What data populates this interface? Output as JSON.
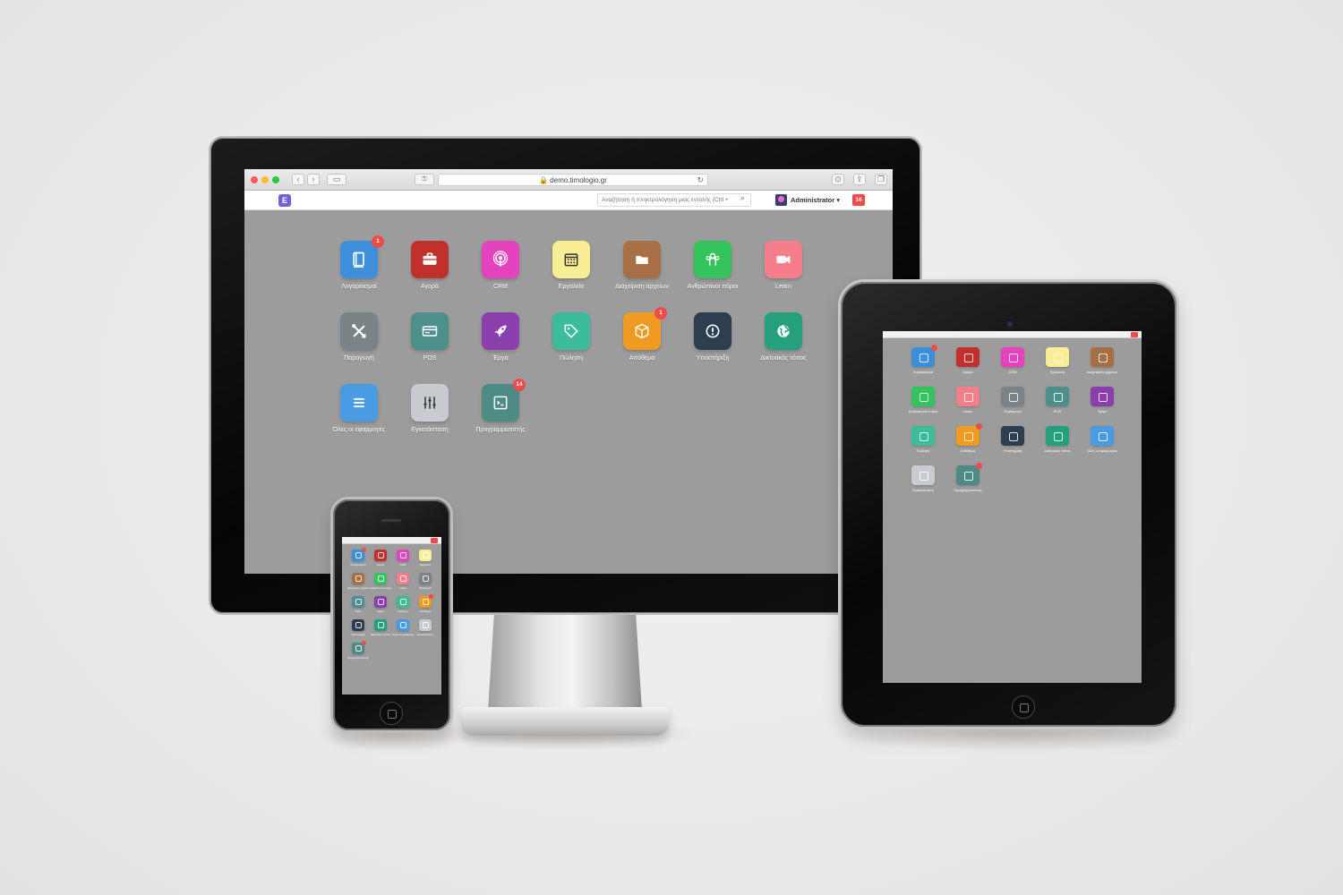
{
  "browser": {
    "url": "demo.timologio.gr",
    "back_label": "‹",
    "forward_label": "›",
    "sidebar_label": "▭",
    "key_label": "⚿",
    "reload_label": "↻",
    "download_label": "⊙",
    "share_label": "⇪",
    "tabs_label": "❐"
  },
  "navbar": {
    "logo_letter": "E",
    "search_placeholder": "Αναζήτηση ή πληκτρολόγηση μιας εντολής (Ctrl + ",
    "user_name": "Administrator ▾",
    "notification_count": "16"
  },
  "apps": [
    {
      "label": "Λογαριασμοί",
      "color": "#3d8fdc",
      "icon": "book-icon",
      "badge": "1"
    },
    {
      "label": "Αγορά",
      "color": "#c0302c",
      "icon": "briefcase-icon",
      "badge": ""
    },
    {
      "label": "CRM",
      "color": "#e542bd",
      "icon": "podcast-icon",
      "badge": ""
    },
    {
      "label": "Εργαλεία",
      "color": "#f9ee96",
      "icon": "calendar-icon",
      "badge": ""
    },
    {
      "label": "Διαχείριση αρχείων",
      "color": "#a66f45",
      "icon": "folder-icon",
      "badge": ""
    },
    {
      "label": "Ανθρώπινοι πόροι",
      "color": "#34c35d",
      "icon": "users-icon",
      "badge": ""
    },
    {
      "label": "Learn",
      "color": "#f47e8a",
      "icon": "video-icon",
      "badge": ""
    },
    {
      "label": "Παραγωγή",
      "color": "#7a8385",
      "icon": "tools-icon",
      "badge": ""
    },
    {
      "label": "POS",
      "color": "#4d8f8a",
      "icon": "card-icon",
      "badge": ""
    },
    {
      "label": "Έργα",
      "color": "#8a3fad",
      "icon": "rocket-icon",
      "badge": ""
    },
    {
      "label": "Πώληση",
      "color": "#3dbc9a",
      "icon": "tag-icon",
      "badge": ""
    },
    {
      "label": "Απόθεμα",
      "color": "#ef9b22",
      "icon": "box-icon",
      "badge": "1"
    },
    {
      "label": "Υποστήριξη",
      "color": "#2c3e50",
      "icon": "alert-icon",
      "badge": ""
    },
    {
      "label": "Δικτυακός τόπος",
      "color": "#24a07d",
      "icon": "globe-icon",
      "badge": ""
    },
    {
      "label": "Όλες οι εφαρμογές",
      "color": "#4a9ce2",
      "icon": "list-icon",
      "badge": ""
    },
    {
      "label": "Εγκατάσταση",
      "color": "#c8ccd0",
      "icon": "sliders-icon",
      "badge": ""
    },
    {
      "label": "Προγραμματιστής",
      "color": "#4e8b86",
      "icon": "code-icon",
      "badge": "14"
    }
  ]
}
